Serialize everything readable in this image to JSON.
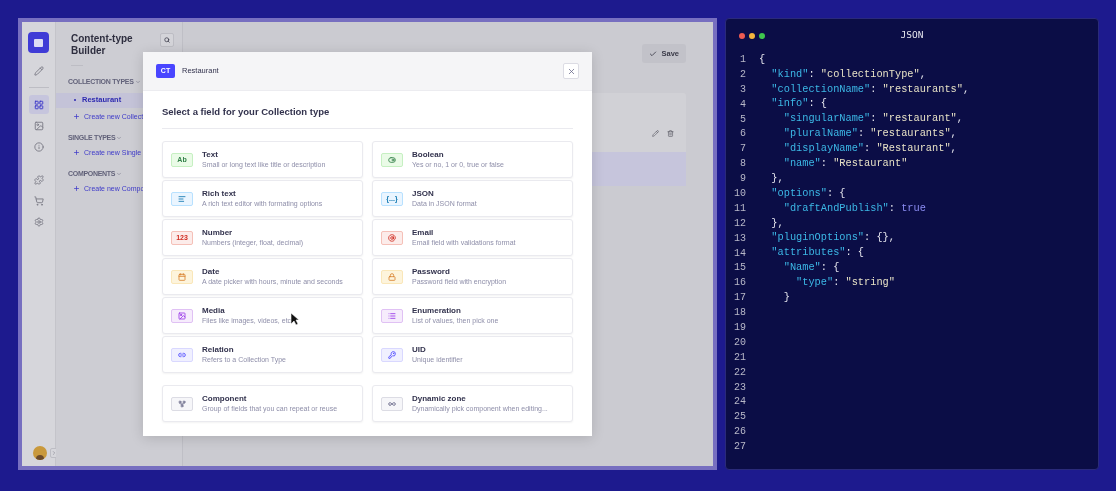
{
  "rail": {
    "items": [
      {
        "kind": "pencil",
        "selected": false
      },
      {
        "kind": "grid",
        "selected": true
      },
      {
        "kind": "image",
        "selected": false
      },
      {
        "kind": "info",
        "selected": false
      },
      {
        "kind": "puzzle",
        "selected": false
      },
      {
        "kind": "cart",
        "selected": false
      },
      {
        "kind": "gear",
        "selected": false
      }
    ]
  },
  "sidebar": {
    "title": "Content-type Builder",
    "sections": [
      {
        "heading": "COLLECTION TYPES",
        "items": [
          {
            "label": "Restaurant",
            "selected": true
          }
        ],
        "create_link": "Create new Collect"
      },
      {
        "heading": "SINGLE TYPES",
        "create_link": "Create new Single"
      },
      {
        "heading": "COMPONENTS",
        "create_link": "Create new Compo"
      }
    ]
  },
  "header": {
    "save_button": "Save"
  },
  "modal": {
    "badge": "CT",
    "title": "Restaurant",
    "heading": "Select a field for your Collection type",
    "fields": [
      {
        "kind": "text",
        "icon_text": "Ab",
        "title": "Text",
        "description": "Small or long text like title or description"
      },
      {
        "kind": "boolean",
        "title": "Boolean",
        "description": "Yes or no, 1 or 0, true or false"
      },
      {
        "kind": "richtext",
        "title": "Rich text",
        "description": "A rich text editor with formating options"
      },
      {
        "kind": "json",
        "icon_text": "{...}",
        "title": "JSON",
        "description": "Data in JSON format"
      },
      {
        "kind": "number",
        "icon_text": "123",
        "title": "Number",
        "description": "Numbers (integer, float, decimal)"
      },
      {
        "kind": "email",
        "title": "Email",
        "description": "Email field with validations format"
      },
      {
        "kind": "date",
        "title": "Date",
        "description": "A date picker with hours, minute and seconds"
      },
      {
        "kind": "password",
        "title": "Password",
        "description": "Password field with encryption"
      },
      {
        "kind": "media",
        "title": "Media",
        "description": "Files like images, videos, etc"
      },
      {
        "kind": "enumeration",
        "title": "Enumeration",
        "description": "List of values, then pick one"
      },
      {
        "kind": "relation",
        "title": "Relation",
        "description": "Refers to a Collection Type"
      },
      {
        "kind": "uid",
        "title": "UID",
        "description": "Unique identifier"
      }
    ],
    "extra_fields": [
      {
        "kind": "component",
        "title": "Component",
        "description": "Group of fields that you can repeat or reuse"
      },
      {
        "kind": "dynamiczone",
        "title": "Dynamic zone",
        "description": "Dynamically pick component when editing..."
      }
    ]
  },
  "code_panel": {
    "title": "JSON",
    "lines": [
      {
        "number": "1",
        "tokens": [
          {
            "kind": "punct",
            "text": "{"
          }
        ]
      },
      {
        "number": "2",
        "tokens": [
          {
            "kind": "key",
            "text": "  \"kind\""
          },
          {
            "kind": "punct",
            "text": ": "
          },
          {
            "kind": "string",
            "text": "\"collectionType\""
          },
          {
            "kind": "punct",
            "text": ","
          }
        ]
      },
      {
        "number": "3",
        "tokens": [
          {
            "kind": "key",
            "text": "  \"collectionName\""
          },
          {
            "kind": "punct",
            "text": ": "
          },
          {
            "kind": "string",
            "text": "\"restaurants\""
          },
          {
            "kind": "punct",
            "text": ","
          }
        ]
      },
      {
        "number": "4",
        "tokens": [
          {
            "kind": "key",
            "text": "  \"info\""
          },
          {
            "kind": "punct",
            "text": ": {"
          }
        ]
      },
      {
        "number": "5",
        "tokens": [
          {
            "kind": "key",
            "text": "    \"singularName\""
          },
          {
            "kind": "punct",
            "text": ": "
          },
          {
            "kind": "string",
            "text": "\"restaurant\""
          },
          {
            "kind": "punct",
            "text": ","
          }
        ]
      },
      {
        "number": "6",
        "tokens": [
          {
            "kind": "key",
            "text": "    \"pluralName\""
          },
          {
            "kind": "punct",
            "text": ": "
          },
          {
            "kind": "string",
            "text": "\"restaurants\""
          },
          {
            "kind": "punct",
            "text": ","
          }
        ]
      },
      {
        "number": "7",
        "tokens": [
          {
            "kind": "key",
            "text": "    \"displayName\""
          },
          {
            "kind": "punct",
            "text": ": "
          },
          {
            "kind": "string",
            "text": "\"Restaurant\""
          },
          {
            "kind": "punct",
            "text": ","
          }
        ]
      },
      {
        "number": "8",
        "tokens": [
          {
            "kind": "key",
            "text": "    \"name\""
          },
          {
            "kind": "punct",
            "text": ": "
          },
          {
            "kind": "string",
            "text": "\"Restaurant\""
          }
        ]
      },
      {
        "number": "9",
        "tokens": [
          {
            "kind": "punct",
            "text": "  },"
          }
        ]
      },
      {
        "number": "10",
        "tokens": [
          {
            "kind": "key",
            "text": "  \"options\""
          },
          {
            "kind": "punct",
            "text": ": {"
          }
        ]
      },
      {
        "number": "11",
        "tokens": [
          {
            "kind": "key",
            "text": "    \"draftAndPublish\""
          },
          {
            "kind": "punct",
            "text": ": "
          },
          {
            "kind": "bool",
            "text": "true"
          }
        ]
      },
      {
        "number": "12",
        "tokens": [
          {
            "kind": "punct",
            "text": "  },"
          }
        ]
      },
      {
        "number": "13",
        "tokens": [
          {
            "kind": "key",
            "text": "  \"pluginOptions\""
          },
          {
            "kind": "punct",
            "text": ": {},"
          }
        ]
      },
      {
        "number": "14",
        "tokens": [
          {
            "kind": "key",
            "text": "  \"attributes\""
          },
          {
            "kind": "punct",
            "text": ": {"
          }
        ]
      },
      {
        "number": "15",
        "tokens": [
          {
            "kind": "key",
            "text": "    \"Name\""
          },
          {
            "kind": "punct",
            "text": ": {"
          }
        ]
      },
      {
        "number": "16",
        "tokens": [
          {
            "kind": "key",
            "text": "      \"type\""
          },
          {
            "kind": "punct",
            "text": ": "
          },
          {
            "kind": "string",
            "text": "\"string\""
          }
        ]
      },
      {
        "number": "17",
        "tokens": [
          {
            "kind": "punct",
            "text": "    }"
          }
        ]
      },
      {
        "number": "18"
      },
      {
        "number": "19"
      },
      {
        "number": "20"
      },
      {
        "number": "21"
      },
      {
        "number": "22"
      },
      {
        "number": "23"
      },
      {
        "number": "24"
      },
      {
        "number": "25"
      },
      {
        "number": "26"
      },
      {
        "number": "27"
      }
    ]
  }
}
